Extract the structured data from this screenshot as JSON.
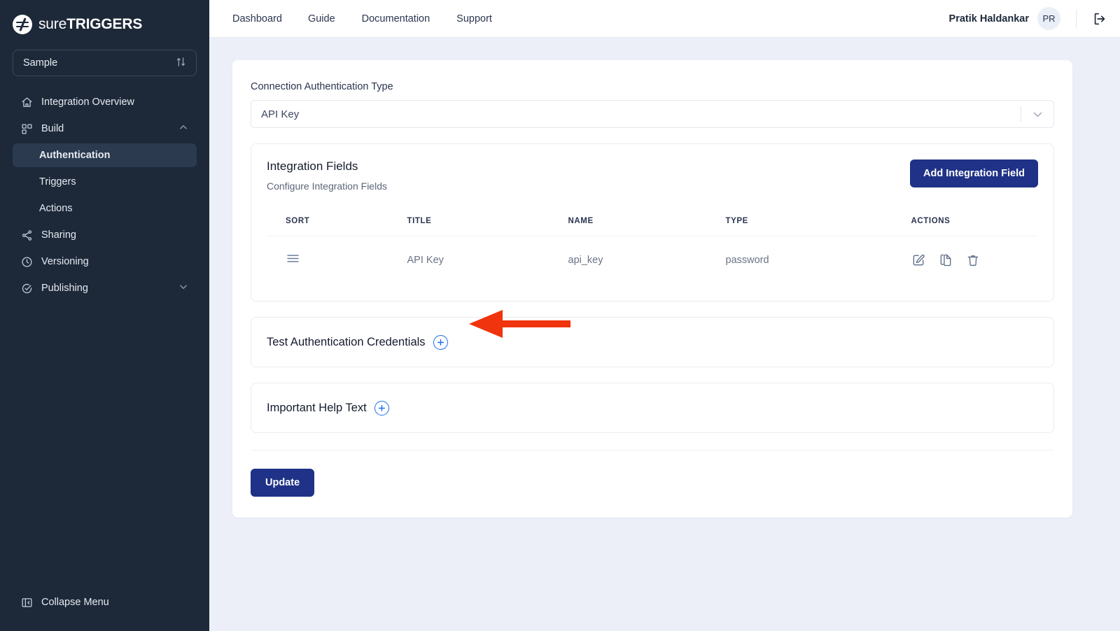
{
  "brand": {
    "name_light": "sure",
    "name_bold": "TRIGGERS",
    "logo_icon": "suretriggers-logo-icon"
  },
  "sidebar": {
    "project_selector": {
      "value": "Sample",
      "icon": "sort-updown-icon"
    },
    "items": [
      {
        "label": "Integration Overview",
        "icon": "home-icon",
        "type": "item",
        "active": false
      },
      {
        "label": "Build",
        "icon": "blocks-icon",
        "type": "item",
        "expanded": true,
        "chevron": "chevron-up-icon"
      },
      {
        "label": "Authentication",
        "type": "sub",
        "active": true
      },
      {
        "label": "Triggers",
        "type": "sub",
        "active": false
      },
      {
        "label": "Actions",
        "type": "sub",
        "active": false
      },
      {
        "label": "Sharing",
        "icon": "share-icon",
        "type": "item",
        "active": false
      },
      {
        "label": "Versioning",
        "icon": "clock-icon",
        "type": "item",
        "active": false
      },
      {
        "label": "Publishing",
        "icon": "check-circle-icon",
        "type": "item",
        "expanded": false,
        "chevron": "chevron-down-icon"
      }
    ],
    "collapse": {
      "label": "Collapse Menu",
      "icon": "panel-collapse-icon"
    }
  },
  "topbar": {
    "nav": [
      {
        "label": "Dashboard"
      },
      {
        "label": "Guide"
      },
      {
        "label": "Documentation"
      },
      {
        "label": "Support"
      }
    ],
    "user_name": "Pratik Haldankar",
    "avatar_initials": "PR",
    "logout_icon": "logout-icon"
  },
  "main": {
    "auth_type": {
      "label": "Connection Authentication Type",
      "value": "API Key",
      "chevron_icon": "chevron-down-icon"
    },
    "integration_fields": {
      "title": "Integration Fields",
      "subtitle": "Configure Integration Fields",
      "add_button": "Add Integration Field",
      "columns": [
        "SORT",
        "TITLE",
        "NAME",
        "TYPE",
        "ACTIONS"
      ],
      "rows": [
        {
          "sort_icon": "drag-handle-icon",
          "title": "API Key",
          "name": "api_key",
          "type": "password",
          "actions": [
            "edit-icon",
            "duplicate-icon",
            "delete-icon"
          ]
        }
      ]
    },
    "test_auth": {
      "title": "Test Authentication Credentials",
      "toggle_icon": "plus-circle-icon"
    },
    "help_text": {
      "title": "Important Help Text",
      "toggle_icon": "plus-circle-icon"
    },
    "update_button": "Update"
  },
  "annotation": {
    "type": "arrow",
    "color": "#f0340d",
    "points_to": "test-auth-plus-button"
  },
  "colors": {
    "sidebar_bg": "#1d2939",
    "page_bg": "#eceff8",
    "primary": "#1f3287",
    "link_blue": "#1b6ef3",
    "annotation_red": "#f0340d"
  }
}
